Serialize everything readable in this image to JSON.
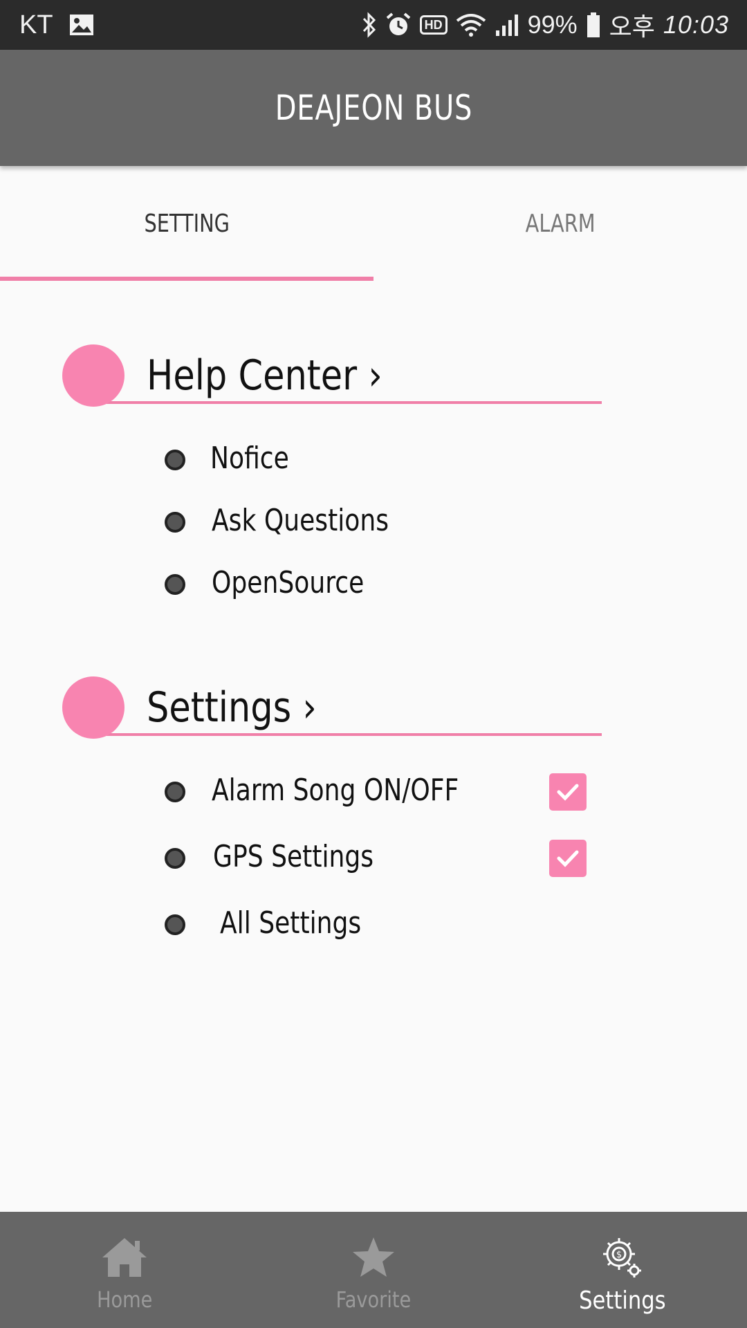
{
  "status_bar": {
    "carrier": "KT",
    "battery": "99%",
    "ampm": "오후",
    "time": "10:03",
    "hd": "HD",
    "icons": [
      "image-icon",
      "bluetooth-icon",
      "alarm-icon",
      "hd-icon",
      "wifi-icon",
      "signal-icon",
      "battery-icon"
    ]
  },
  "app_bar": {
    "title": "DEAJEON BUS"
  },
  "tabs": [
    {
      "label": "SETTING",
      "active": true
    },
    {
      "label": "ALARM",
      "active": false
    }
  ],
  "sections": {
    "help": {
      "title": "Help Center ›",
      "items": [
        {
          "label": "Nofice"
        },
        {
          "label": "Ask Questions"
        },
        {
          "label": "OpenSource"
        }
      ]
    },
    "settings": {
      "title": "Settings ›",
      "items": [
        {
          "label": "Alarm Song ON/OFF",
          "checked": true
        },
        {
          "label": "GPS Settings",
          "checked": true
        },
        {
          "label": "All Settings"
        }
      ]
    }
  },
  "bottom_nav": [
    {
      "label": "Home",
      "icon": "home-icon",
      "active": false
    },
    {
      "label": "Favorite",
      "icon": "star-icon",
      "active": false
    },
    {
      "label": "Settings",
      "icon": "settings-gear-icon",
      "active": true
    }
  ],
  "colors": {
    "accent": "#f884b0",
    "appbar": "#666666",
    "statusbar": "#2b2b2b",
    "background": "#fafafa"
  }
}
